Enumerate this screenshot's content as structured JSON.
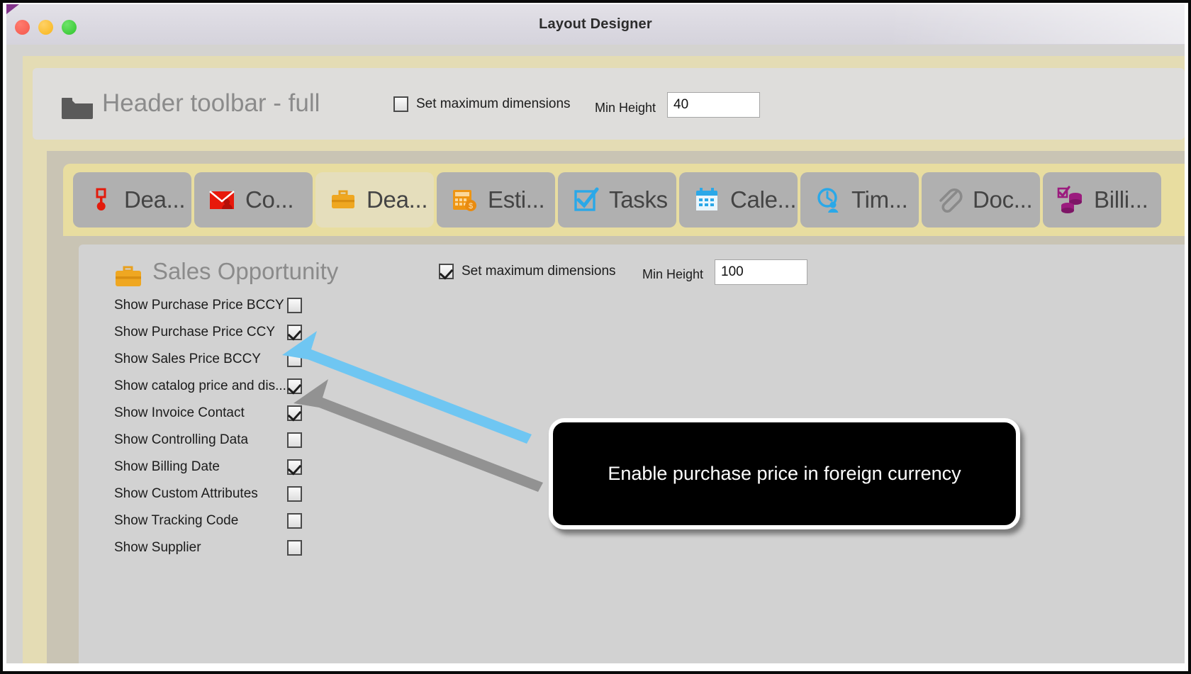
{
  "window": {
    "title": "Layout Designer",
    "controls": {
      "close": "close",
      "minimize": "minimize",
      "maximize": "maximize"
    }
  },
  "header_panel": {
    "icon": "folder-icon",
    "title": "Header toolbar - full",
    "set_max_dimensions": {
      "label": "Set maximum dimensions",
      "checked": false
    },
    "min_height": {
      "label": "Min Height",
      "value": "40"
    }
  },
  "tabs": [
    {
      "label": "Dea...",
      "icon": "pin-icon",
      "active": false,
      "color": "#e01b10"
    },
    {
      "label": "Co...",
      "icon": "mail-contact-icon",
      "active": false,
      "color": "#e01b10"
    },
    {
      "label": "Dea...",
      "icon": "briefcase-icon",
      "active": true,
      "color": "#eda01e"
    },
    {
      "label": "Esti...",
      "icon": "calculator-icon",
      "active": false,
      "color": "#ef9512"
    },
    {
      "label": "Tasks",
      "icon": "checkbox-icon",
      "active": false,
      "color": "#2aa8e8"
    },
    {
      "label": "Cale...",
      "icon": "calendar-icon",
      "active": false,
      "color": "#2aa8e8"
    },
    {
      "label": "Tim...",
      "icon": "clock-user-icon",
      "active": false,
      "color": "#2aa8e8"
    },
    {
      "label": "Doc...",
      "icon": "paperclip-icon",
      "active": false,
      "color": "#7d7d7d"
    },
    {
      "label": "Billi...",
      "icon": "coins-check-icon",
      "active": false,
      "color": "#9b1b7e"
    }
  ],
  "content_panel": {
    "icon": "briefcase-icon",
    "title": "Sales Opportunity",
    "set_max_dimensions": {
      "label": "Set maximum dimensions",
      "checked": true
    },
    "min_height": {
      "label": "Min Height",
      "value": "100"
    },
    "options": [
      {
        "label": "Show Purchase Price BCCY",
        "checked": false
      },
      {
        "label": "Show Purchase Price CCY",
        "checked": true
      },
      {
        "label": "Show Sales Price BCCY",
        "checked": false
      },
      {
        "label": "Show catalog price and dis...",
        "checked": true
      },
      {
        "label": "Show Invoice Contact",
        "checked": true
      },
      {
        "label": "Show Controlling Data",
        "checked": false
      },
      {
        "label": "Show Billing Date",
        "checked": true
      },
      {
        "label": "Show Custom Attributes",
        "checked": false
      },
      {
        "label": "Show Tracking Code",
        "checked": false
      },
      {
        "label": "Show Supplier",
        "checked": false
      }
    ]
  },
  "callout": {
    "text": "Enable purchase price in foreign currency",
    "background": "#000000",
    "border": "#ffffff",
    "text_color": "#ffffff"
  },
  "annotation_arrow": {
    "color": "#6fc6f2",
    "points_to": "Show Purchase Price CCY checkbox"
  }
}
